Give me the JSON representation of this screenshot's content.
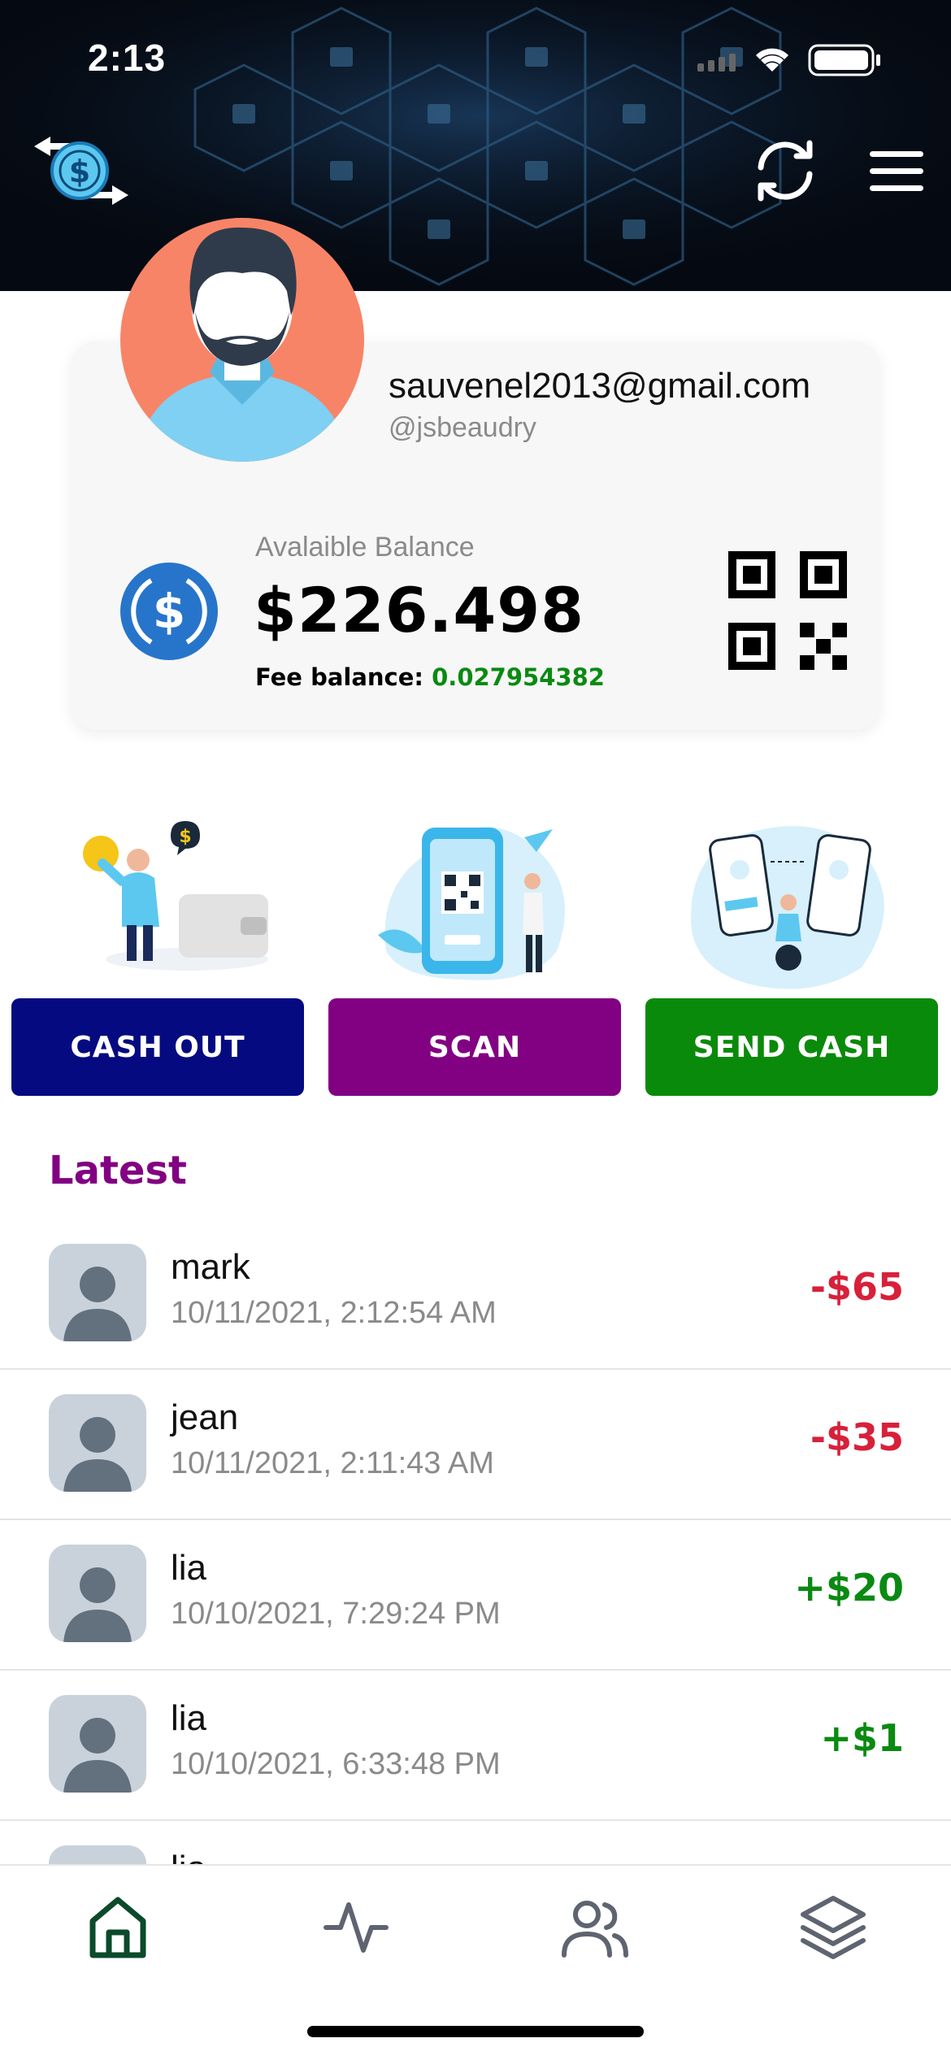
{
  "status_bar": {
    "time": "2:13"
  },
  "profile": {
    "email": "sauvenel2013@gmail.com",
    "handle": "@jsbeaudry",
    "balance_label": "Avalaible Balance",
    "balance": "$226.498",
    "fee_label": "Fee balance:",
    "fee_value": "0.027954382"
  },
  "actions": {
    "cash_out": "CASH OUT",
    "scan": "SCAN",
    "send_cash": "SEND CASH"
  },
  "latest_title": "Latest",
  "transactions": [
    {
      "name": "mark",
      "date": "10/11/2021, 2:12:54 AM",
      "amount": "-$65"
    },
    {
      "name": "jean",
      "date": "10/11/2021, 2:11:43 AM",
      "amount": "-$35"
    },
    {
      "name": "lia",
      "date": "10/10/2021, 7:29:24 PM",
      "amount": "+$20"
    },
    {
      "name": "lia",
      "date": "10/10/2021, 6:33:48 PM",
      "amount": "+$1"
    },
    {
      "name": "lia",
      "date": "",
      "amount": ""
    }
  ],
  "colors": {
    "cash_out_bg": "#050a80",
    "scan_bg": "#820082",
    "send_cash_bg": "#0a8a0a",
    "negative": "#d8203a",
    "positive": "#0a8a12",
    "active_tab": "#0b4a2a"
  },
  "tabs": [
    {
      "icon": "home-icon",
      "active": true
    },
    {
      "icon": "activity-icon",
      "active": false
    },
    {
      "icon": "users-icon",
      "active": false
    },
    {
      "icon": "layers-icon",
      "active": false
    }
  ]
}
